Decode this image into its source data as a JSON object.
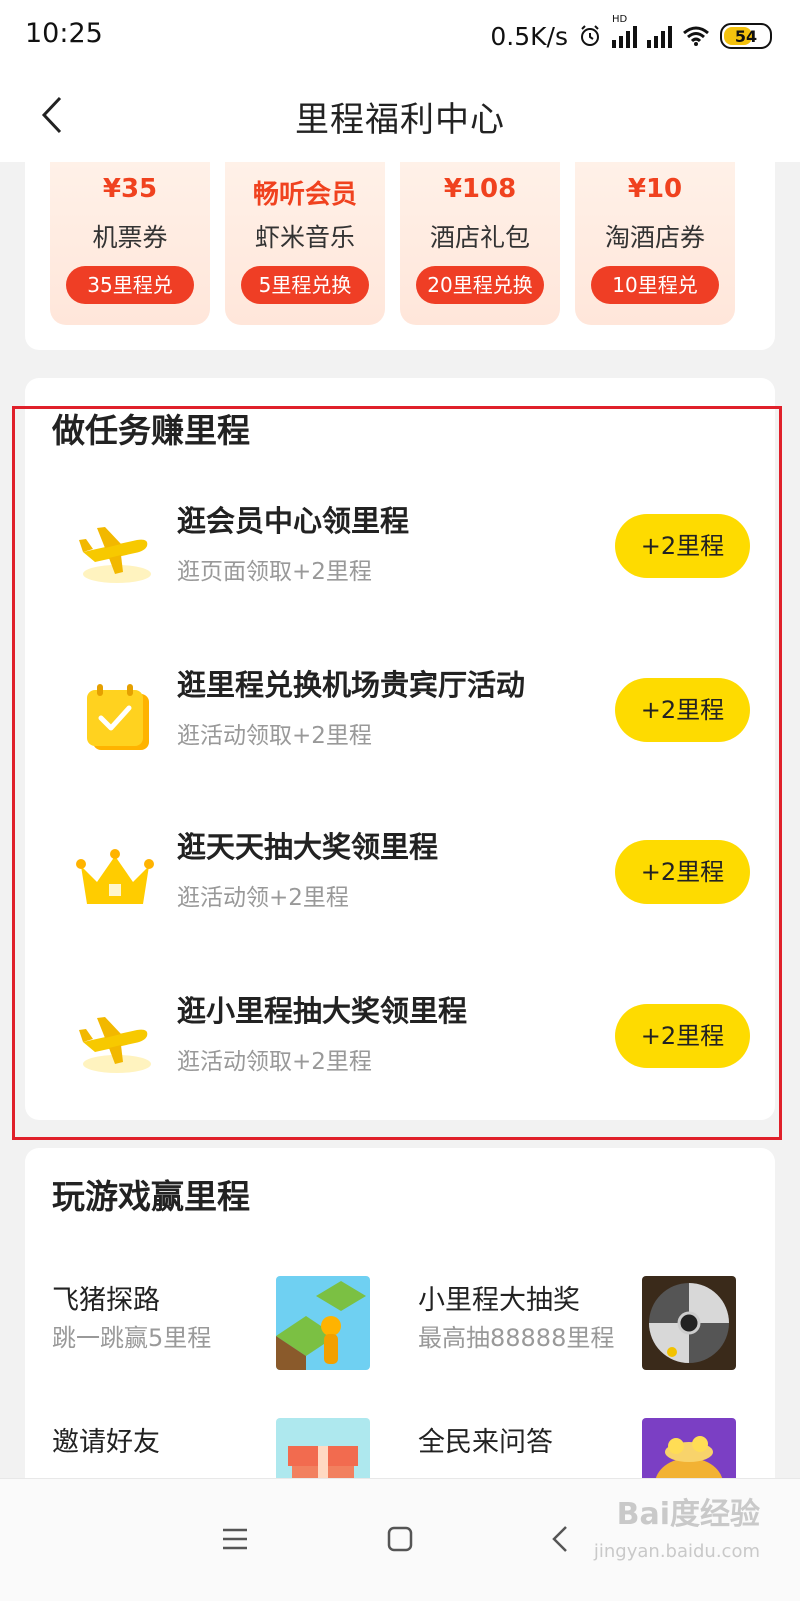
{
  "status_bar": {
    "time": "10:25",
    "speed": "0.5K/s",
    "hd": "HD",
    "battery": "54"
  },
  "header": {
    "title": "里程福利中心"
  },
  "exchange": {
    "items": [
      {
        "value": "¥35",
        "name": "机票券",
        "button": "35里程兑"
      },
      {
        "value": "畅听会员",
        "name": "虾米音乐",
        "button": "5里程兑换"
      },
      {
        "value": "¥108",
        "name": "酒店礼包",
        "button": "20里程兑换"
      },
      {
        "value": "¥10",
        "name": "淘酒店券",
        "button": "10里程兑"
      }
    ]
  },
  "tasks": {
    "title": "做任务赚里程",
    "items": [
      {
        "icon": "plane-icon",
        "title": "逛会员中心领里程",
        "subtitle": "逛页面领取+2里程",
        "button": "+2里程"
      },
      {
        "icon": "calendar-check-icon",
        "title": "逛里程兑换机场贵宾厅活动",
        "subtitle": "逛活动领取+2里程",
        "button": "+2里程"
      },
      {
        "icon": "crown-icon",
        "title": "逛天天抽大奖领里程",
        "subtitle": "逛活动领+2里程",
        "button": "+2里程"
      },
      {
        "icon": "plane-icon",
        "title": "逛小里程抽大奖领里程",
        "subtitle": "逛活动领取+2里程",
        "button": "+2里程"
      }
    ]
  },
  "games": {
    "title": "玩游戏赢里程",
    "items": [
      {
        "name": "飞猪探路",
        "subtitle": "跳一跳赢5里程",
        "icon": "jump-game-icon"
      },
      {
        "name": "小里程大抽奖",
        "subtitle": "最高抽88888里程",
        "icon": "lucky-wheel-icon"
      },
      {
        "name": "邀请好友",
        "subtitle": "",
        "icon": "gift-box-icon"
      },
      {
        "name": "全民来问答",
        "subtitle": "",
        "icon": "money-bag-icon"
      }
    ]
  },
  "watermark": {
    "main": "Bai度经验",
    "sub": "jingyan.baidu.com"
  },
  "colors": {
    "accent_red": "#ef3e25",
    "reward_yellow": "#fedb00",
    "highlight_border": "#e0202a"
  }
}
